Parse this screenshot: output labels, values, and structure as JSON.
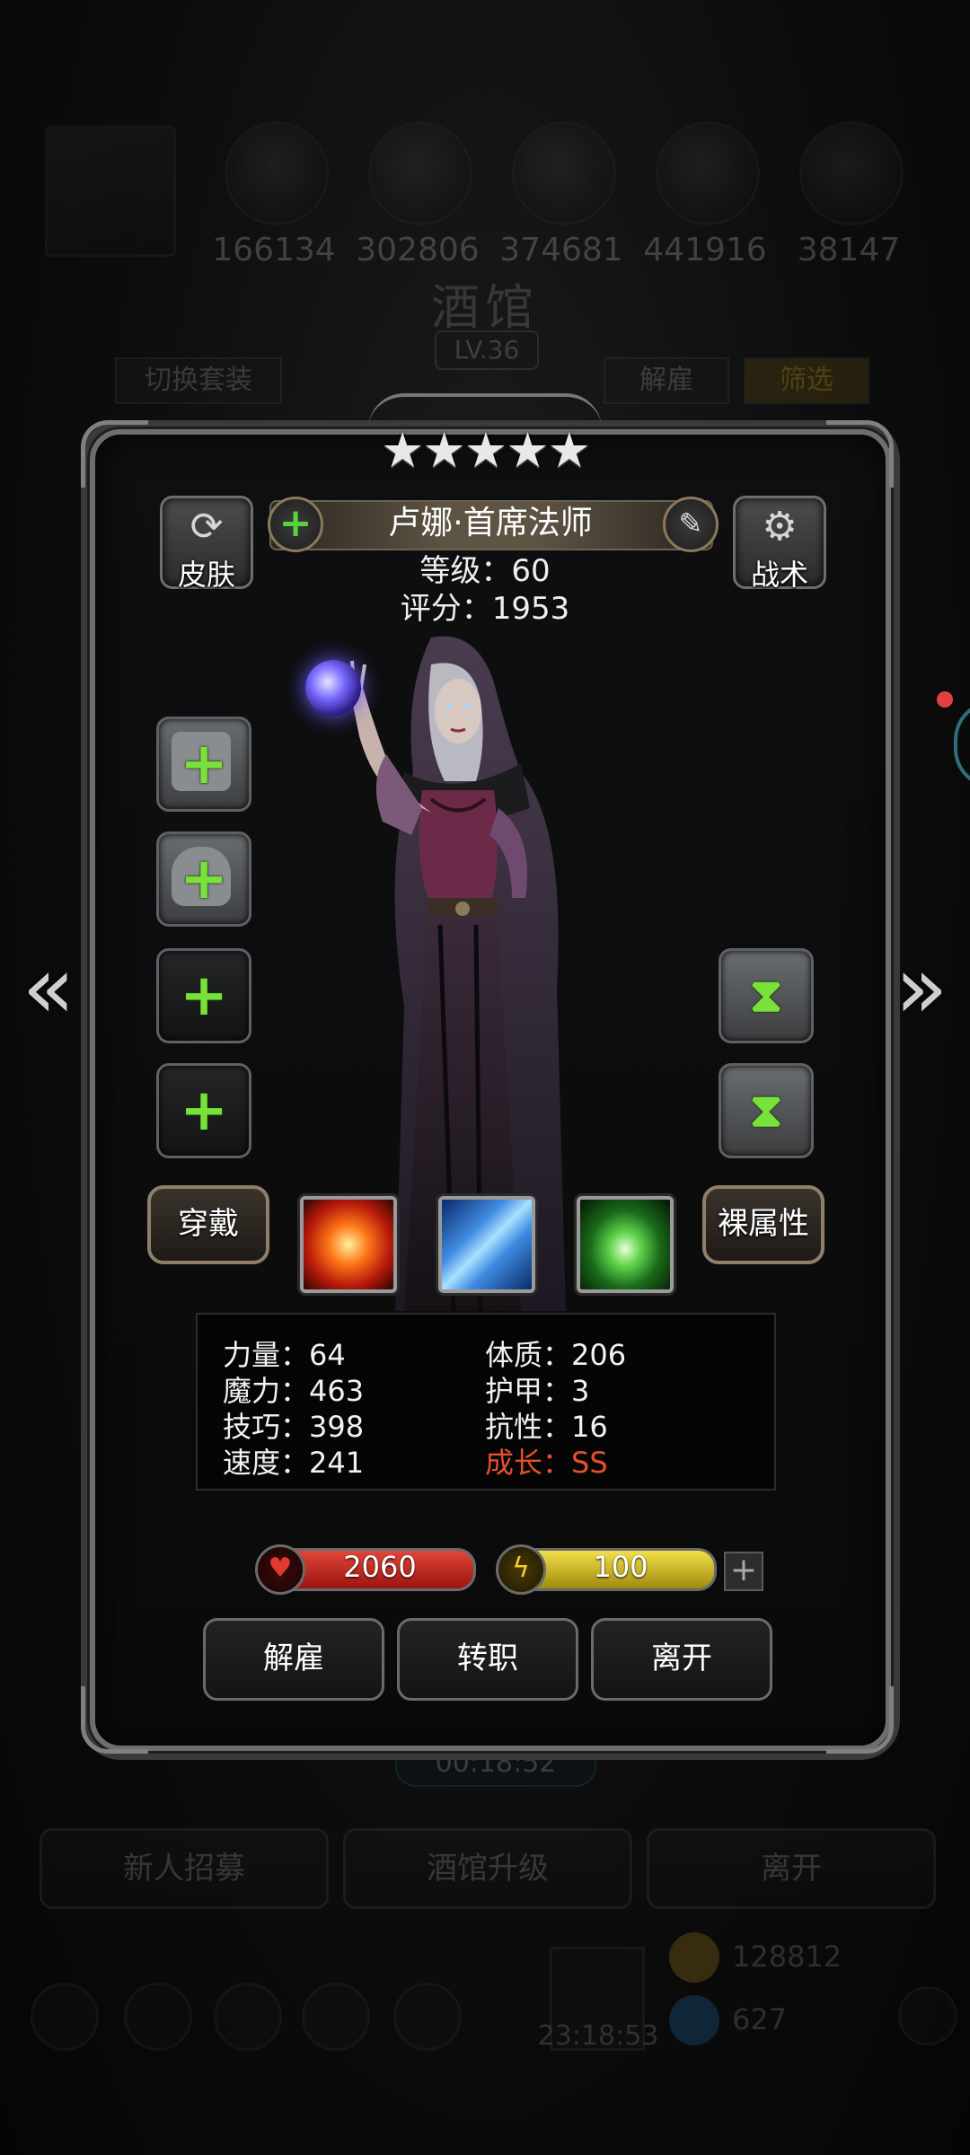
{
  "background": {
    "resource_values": [
      "166134",
      "302806",
      "374681",
      "441916",
      "38147"
    ],
    "screen_title": "酒馆",
    "level_badge": "LV.36",
    "tab_switch_outfit": "切换套装",
    "tab_dismiss": "解雇",
    "tab_filter": "筛选",
    "timer": "00:18:52",
    "buttons": [
      "新人招募",
      "酒馆升级",
      "离开"
    ],
    "gift_timer": "23:18:53",
    "gold": "128812",
    "gems": "627",
    "accent_gold": "#c9a227"
  },
  "hero": {
    "stars": "★★★★★",
    "name": "卢娜·首席法师",
    "level_line": "等级：60",
    "score_line": "评分：1953",
    "skin_label": "皮肤",
    "tactics_label": "战术",
    "equip_button": "穿戴",
    "base_attr_button": "裸属性"
  },
  "stats": {
    "strength": "力量：64",
    "magic": "魔力：463",
    "skill": "技巧：398",
    "speed": "速度：241",
    "constitution": "体质：206",
    "armor": "护甲：3",
    "resistance": "抗性：16",
    "growth": "成长：SS",
    "growth_color": "#e4502e"
  },
  "bars": {
    "hp": "2060",
    "energy": "100",
    "hp_color": "#c4221c",
    "energy_color": "#d8c21f"
  },
  "actions": {
    "dismiss": "解雇",
    "transfer": "转职",
    "leave": "离开"
  },
  "icons": [
    "shirt-swap-icon",
    "gear-icon",
    "edit-pencil-icon",
    "plus-icon",
    "hourglass-icon",
    "heart-icon",
    "lightning-icon"
  ]
}
